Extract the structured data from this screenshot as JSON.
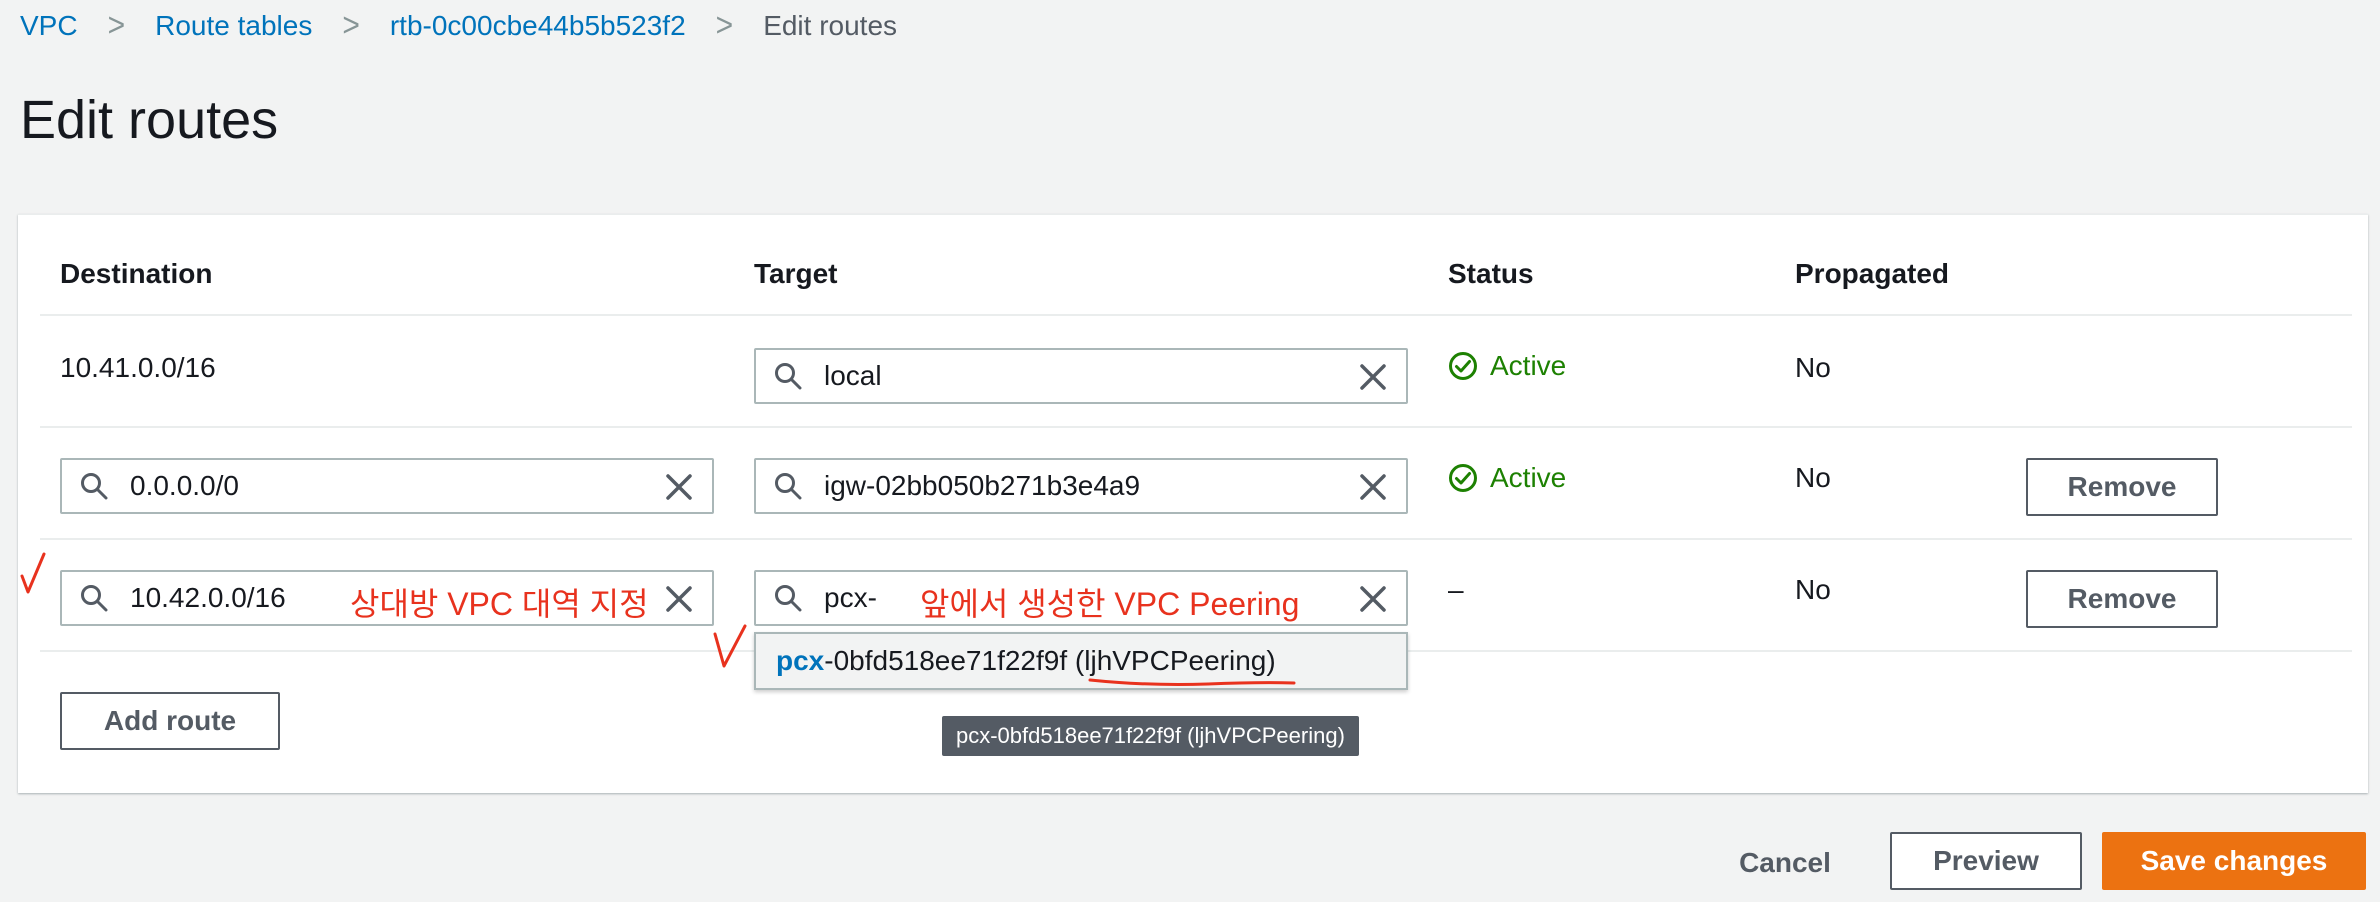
{
  "breadcrumb": {
    "items": [
      "VPC",
      "Route tables",
      "rtb-0c00cbe44b5b523f2"
    ],
    "current": "Edit routes",
    "separator": ">"
  },
  "page_title": "Edit routes",
  "table": {
    "headers": {
      "destination": "Destination",
      "target": "Target",
      "status": "Status",
      "propagated": "Propagated"
    },
    "rows": [
      {
        "destination": "10.41.0.0/16",
        "target": "local",
        "status": "Active",
        "propagated": "No"
      },
      {
        "destination": "0.0.0.0/0",
        "target": "igw-02bb050b271b3e4a9",
        "status": "Active",
        "propagated": "No",
        "remove": "Remove"
      },
      {
        "destination": "10.42.0.0/16",
        "target": "pcx-",
        "status": "–",
        "propagated": "No",
        "remove": "Remove"
      }
    ]
  },
  "dropdown": {
    "match": "pcx",
    "rest": "-0bfd518ee71f22f9f",
    "name": "(ljhVPCPeering)"
  },
  "tooltip": "pcx-0bfd518ee71f22f9f (ljhVPCPeering)",
  "annotations": {
    "destination_note": "상대방 VPC 대역 지정",
    "target_note": "앞에서 생성한 VPC Peering"
  },
  "buttons": {
    "add_route": "Add route",
    "cancel": "Cancel",
    "preview": "Preview",
    "save": "Save changes"
  },
  "colors": {
    "link": "#0073bb",
    "success": "#1d8102",
    "primary": "#ec7211",
    "annotation": "#e8321e"
  },
  "icons": [
    "search-icon",
    "close-icon",
    "status-positive-icon",
    "chevron-right-icon"
  ]
}
